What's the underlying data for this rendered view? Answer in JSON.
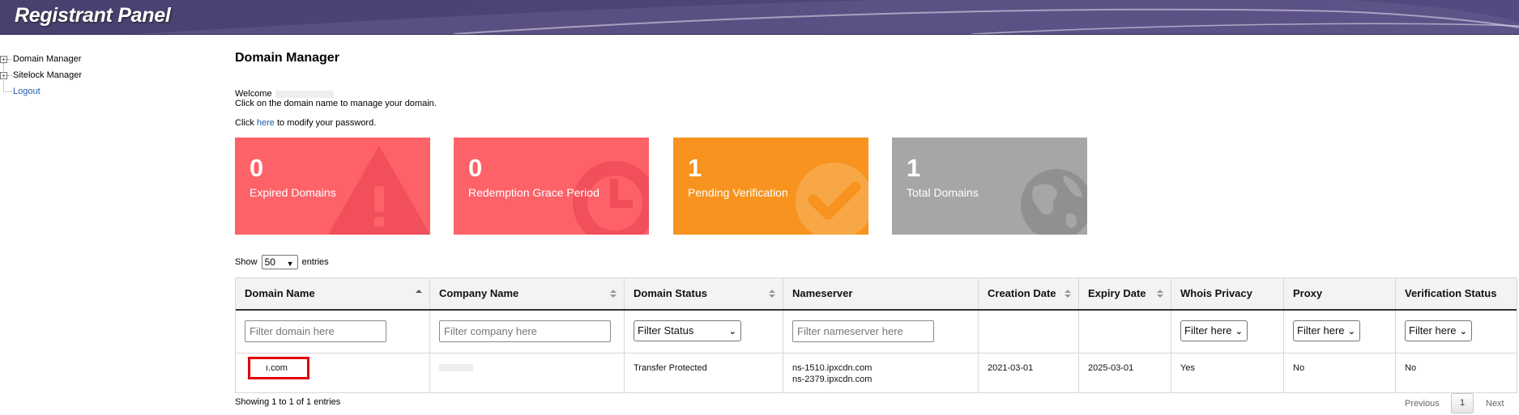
{
  "header": {
    "title": "Registrant Panel"
  },
  "sidebar": {
    "items": [
      {
        "label": "Domain Manager",
        "toggle": "+"
      },
      {
        "label": "Sitelock Manager",
        "toggle": "+"
      },
      {
        "label": "Logout"
      }
    ]
  },
  "main": {
    "title": "Domain Manager",
    "welcome": "Welcome",
    "instructions": "Click on the domain name to manage your domain.",
    "password_prefix": "Click",
    "password_link": "here",
    "password_suffix": "to modify your password."
  },
  "cards": [
    {
      "count": "0",
      "label": "Expired Domains",
      "color": "#fd6269",
      "icon": "warning-icon"
    },
    {
      "count": "0",
      "label": "Redemption Grace Period",
      "color": "#fd6269",
      "icon": "clock-icon"
    },
    {
      "count": "1",
      "label": "Pending Verification",
      "color": "#f7931e",
      "icon": "check-circle-icon"
    },
    {
      "count": "1",
      "label": "Total Domains",
      "color": "#a6a6a6",
      "icon": "globe-icon"
    }
  ],
  "entries": {
    "show": "Show",
    "value": "50",
    "suffix": "entries"
  },
  "table": {
    "headers": [
      "Domain Name",
      "Company Name",
      "Domain Status",
      "Nameserver",
      "Creation Date",
      "Expiry Date",
      "Whois Privacy",
      "Proxy",
      "Verification Status"
    ],
    "filters": {
      "domain": "Filter domain here",
      "company": "Filter company here",
      "status": "Filter Status",
      "nameserver": "Filter nameserver here",
      "whois": "Filter here",
      "proxy": "Filter here",
      "verification": "Filter here"
    },
    "rows": [
      {
        "domain": "ı.com",
        "company": "",
        "status": "Transfer Protected",
        "ns1": "ns-1510.ipxcdn.com",
        "ns2": "ns-2379.ipxcdn.com",
        "created": "2021-03-01",
        "expiry": "2025-03-01",
        "whois": "Yes",
        "proxy": "No",
        "verification": "No"
      }
    ]
  },
  "footer": {
    "info": "Showing 1 to 1 of 1 entries",
    "previous": "Previous",
    "page": "1",
    "next": "Next"
  }
}
